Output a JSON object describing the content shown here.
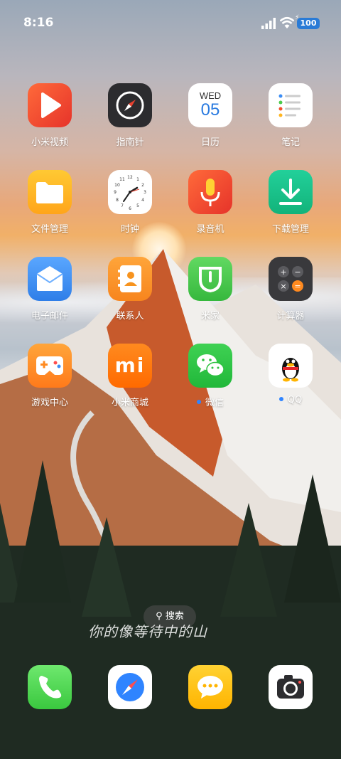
{
  "status_bar": {
    "time": "8:16",
    "battery": "100"
  },
  "apps": [
    {
      "label": "小米视频"
    },
    {
      "label": "指南针"
    },
    {
      "label": "日历",
      "day": "WED",
      "date": "05"
    },
    {
      "label": "笔记"
    },
    {
      "label": "文件管理"
    },
    {
      "label": "时钟"
    },
    {
      "label": "录音机"
    },
    {
      "label": "下载管理"
    },
    {
      "label": "电子邮件"
    },
    {
      "label": "联系人"
    },
    {
      "label": "米家"
    },
    {
      "label": "计算器"
    },
    {
      "label": "游戏中心"
    },
    {
      "label": "小米商城",
      "brand": "mi"
    },
    {
      "label": "微信"
    },
    {
      "label": "QQ"
    }
  ],
  "search": {
    "label": "搜索"
  },
  "wallpaper_text": "你的像等待中的山",
  "dock": [
    {
      "name": "phone"
    },
    {
      "name": "browser"
    },
    {
      "name": "messages"
    },
    {
      "name": "camera"
    }
  ],
  "colors": {
    "video": "#f04a2f",
    "compass": "#2b2b2e",
    "files": "#ffb51f",
    "recorder": "#f24d2b",
    "download": "#19c18a",
    "mail": "#3b8df5",
    "contacts": "#f7931e",
    "mihome": "#4ccb4c",
    "calculator": "#3a3a3c",
    "game": "#ff8a1f",
    "store": "#ff6a00",
    "wechat": "#2dc140"
  }
}
